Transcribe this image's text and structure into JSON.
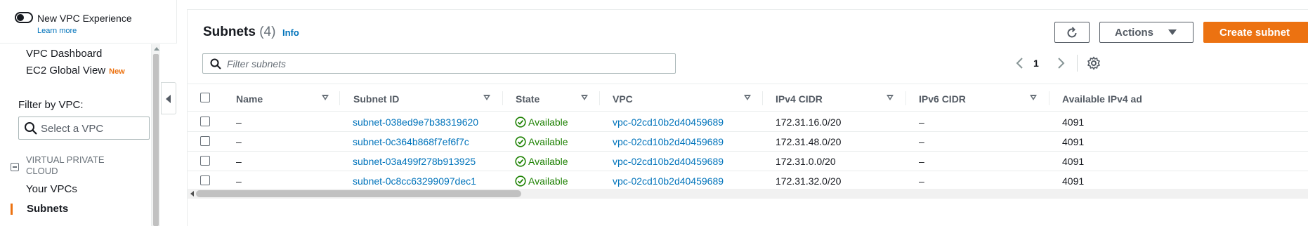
{
  "vpc_experience": {
    "title": "New VPC Experience",
    "learn_more": "Learn more",
    "enabled": false
  },
  "sidebar": {
    "items": [
      {
        "label": "VPC Dashboard"
      },
      {
        "label": "EC2 Global View",
        "badge": "New"
      }
    ],
    "filter_label": "Filter by VPC:",
    "filter_placeholder": "Select a VPC",
    "section": {
      "title": "VIRTUAL PRIVATE CLOUD",
      "items": [
        {
          "label": "Your VPCs"
        },
        {
          "label": "Subnets",
          "active": true
        }
      ]
    }
  },
  "header": {
    "title": "Subnets",
    "count": "(4)",
    "info": "Info",
    "actions_label": "Actions",
    "create_label": "Create subnet"
  },
  "filter": {
    "placeholder": "Filter subnets"
  },
  "pagination": {
    "current_page": "1"
  },
  "table": {
    "columns": [
      "Name",
      "Subnet ID",
      "State",
      "VPC",
      "IPv4 CIDR",
      "IPv6 CIDR",
      "Available IPv4 ad"
    ],
    "rows": [
      {
        "name": "–",
        "subnet_id": "subnet-038ed9e7b38319620",
        "state": "Available",
        "vpc": "vpc-02cd10b2d40459689",
        "ipv4_cidr": "172.31.16.0/20",
        "ipv6_cidr": "–",
        "available_ipv4": "4091"
      },
      {
        "name": "–",
        "subnet_id": "subnet-0c364b868f7ef6f7c",
        "state": "Available",
        "vpc": "vpc-02cd10b2d40459689",
        "ipv4_cidr": "172.31.48.0/20",
        "ipv6_cidr": "–",
        "available_ipv4": "4091"
      },
      {
        "name": "–",
        "subnet_id": "subnet-03a499f278b913925",
        "state": "Available",
        "vpc": "vpc-02cd10b2d40459689",
        "ipv4_cidr": "172.31.0.0/20",
        "ipv6_cidr": "–",
        "available_ipv4": "4091"
      },
      {
        "name": "–",
        "subnet_id": "subnet-0c8cc63299097dec1",
        "state": "Available",
        "vpc": "vpc-02cd10b2d40459689",
        "ipv4_cidr": "172.31.32.0/20",
        "ipv6_cidr": "–",
        "available_ipv4": "4091"
      }
    ]
  },
  "colors": {
    "accent": "#ec7211",
    "link": "#0073bb",
    "success": "#1d8102"
  }
}
